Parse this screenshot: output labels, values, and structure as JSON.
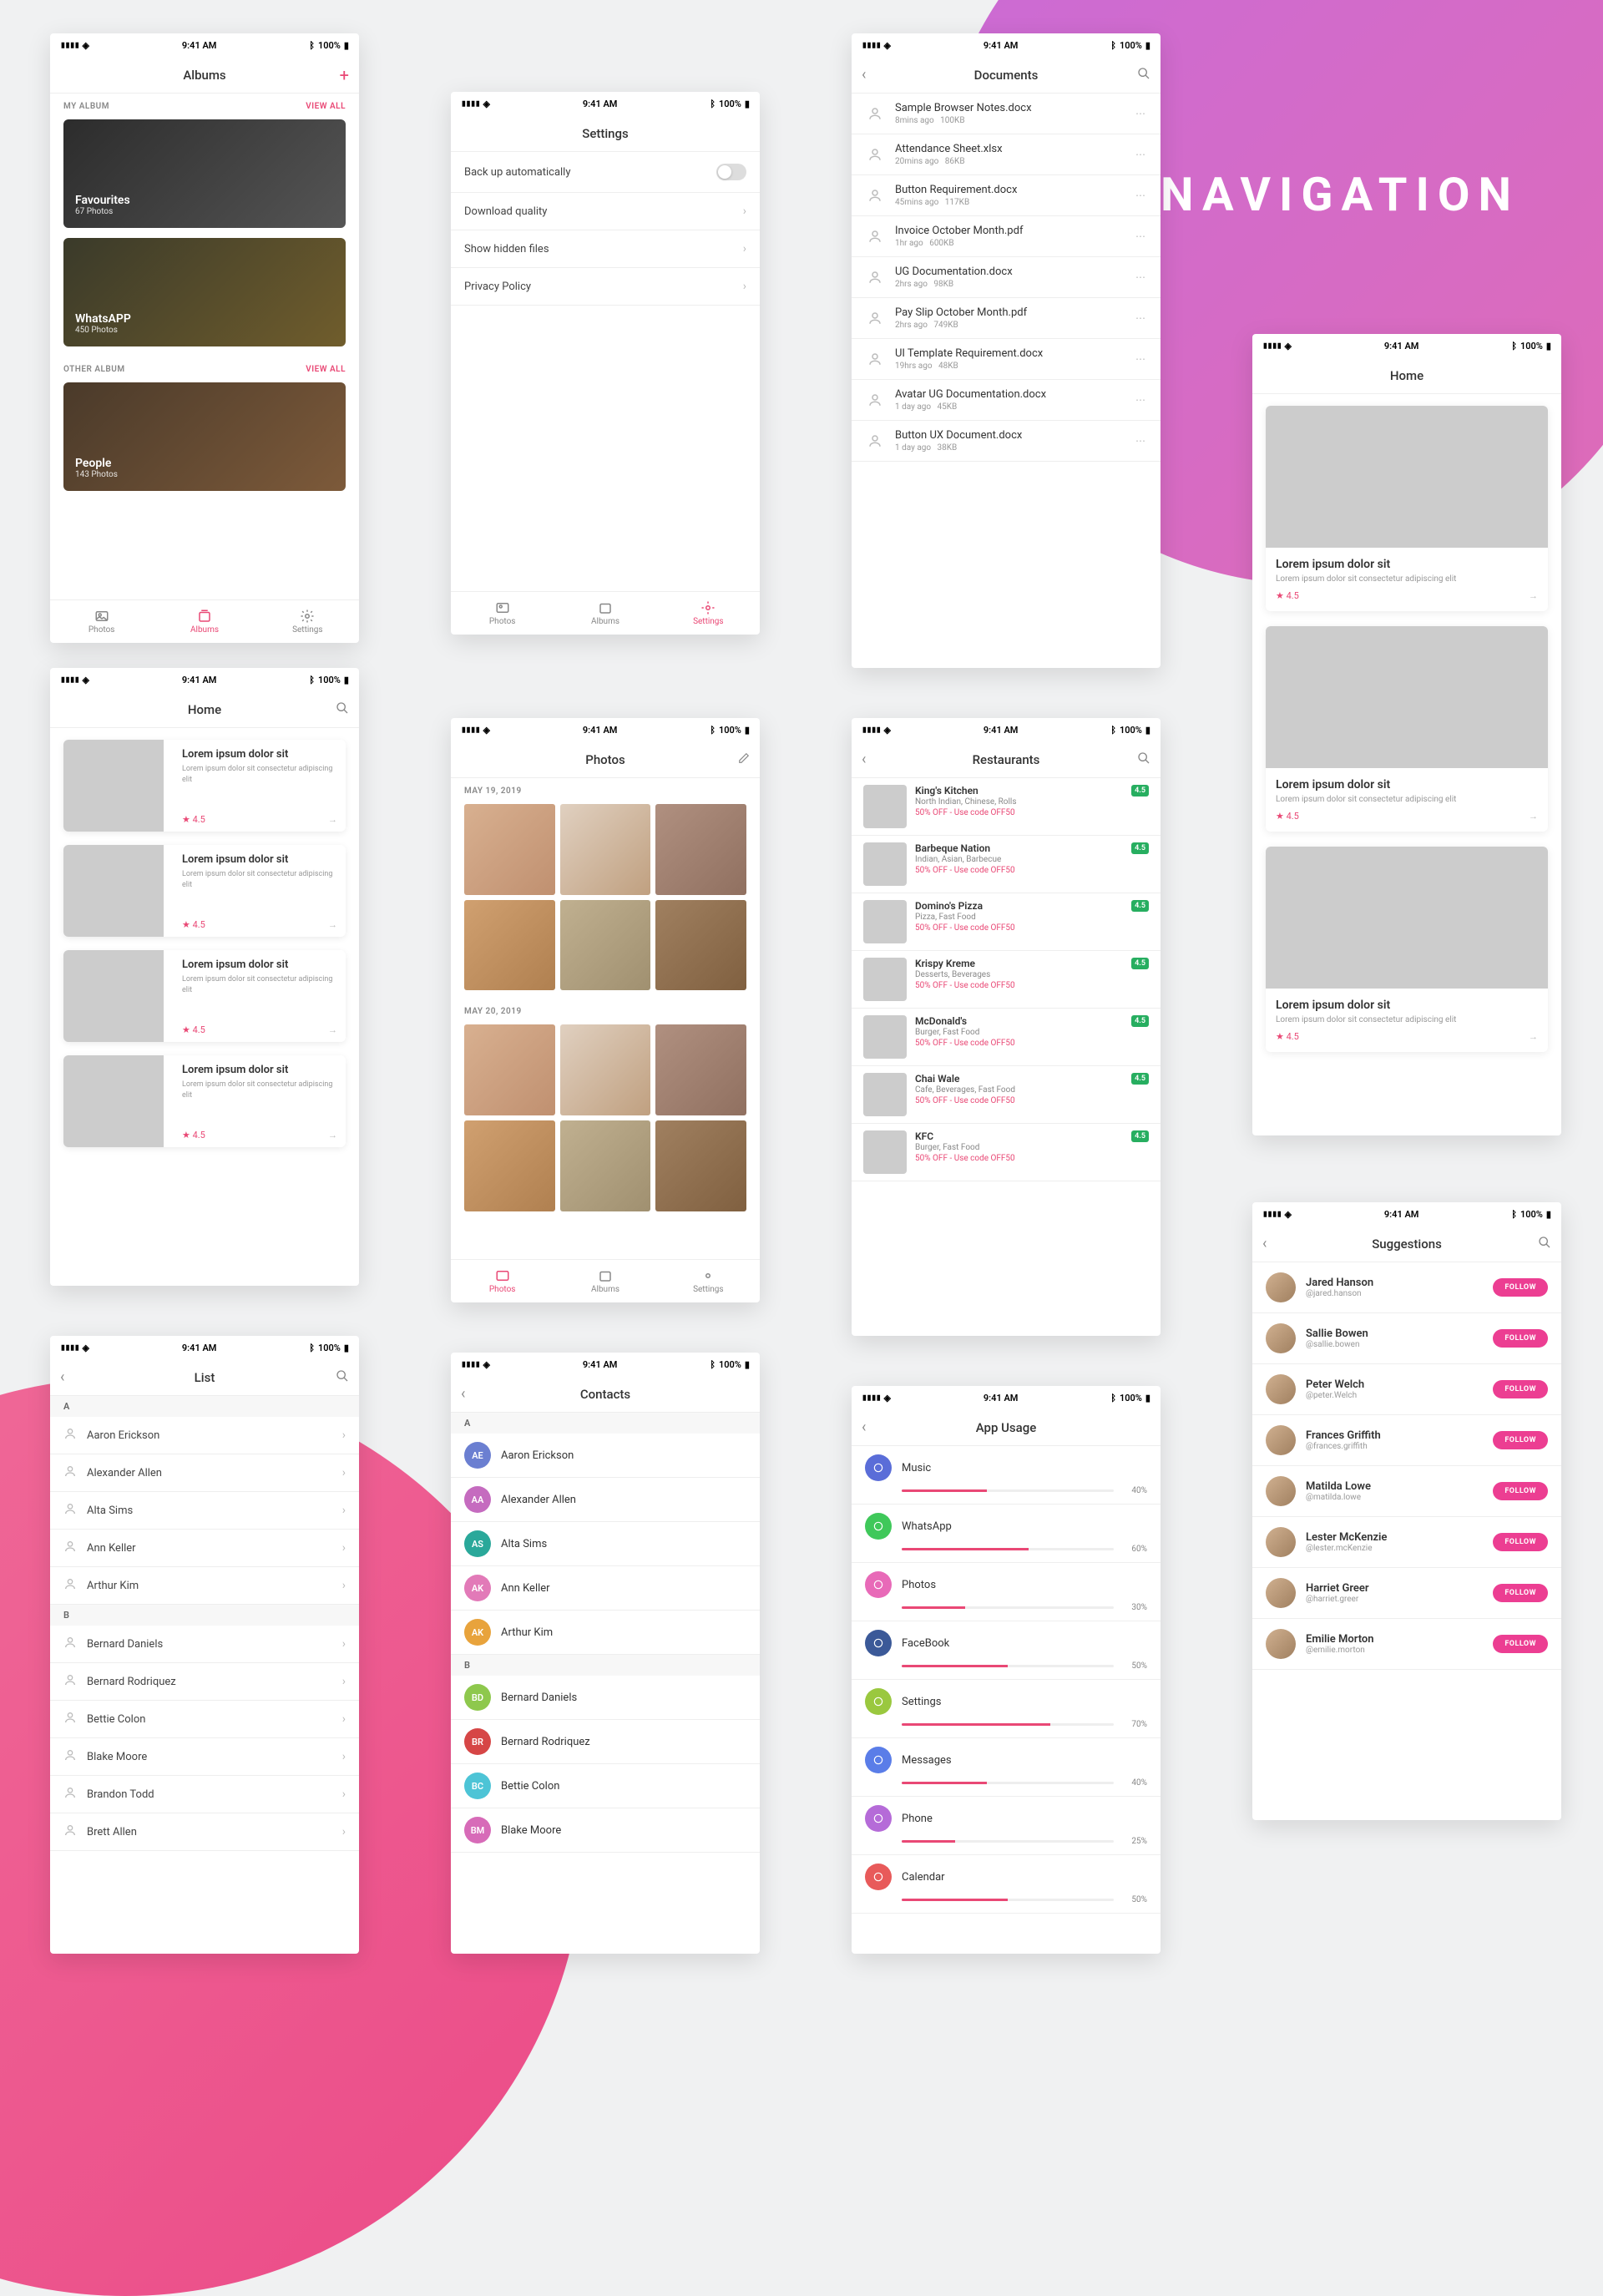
{
  "hero": "NAVIGATION",
  "statusbar": {
    "time": "9:41 AM",
    "battery": "100%"
  },
  "tabs": {
    "photos": "Photos",
    "albums": "Albums",
    "settings": "Settings"
  },
  "albums": {
    "title": "Albums",
    "sections": [
      {
        "header": "MY ALBUM",
        "viewall": "VIEW ALL",
        "cards": [
          {
            "title": "Favourites",
            "sub": "67 Photos"
          },
          {
            "title": "WhatsAPP",
            "sub": "450 Photos"
          }
        ]
      },
      {
        "header": "OTHER ALBUM",
        "viewall": "VIEW ALL",
        "cards": [
          {
            "title": "People",
            "sub": "143 Photos"
          }
        ]
      }
    ]
  },
  "settings": {
    "title": "Settings",
    "rows": [
      {
        "label": "Back up automatically",
        "type": "toggle"
      },
      {
        "label": "Download  quality",
        "type": "chev"
      },
      {
        "label": "Show hidden files",
        "type": "chev"
      },
      {
        "label": "Privacy Policy",
        "type": "chev"
      }
    ]
  },
  "documents": {
    "title": "Documents",
    "rows": [
      {
        "name": "Sample Browser Notes.docx",
        "time": "8mins ago",
        "size": "100KB"
      },
      {
        "name": "Attendance Sheet.xlsx",
        "time": "20mins ago",
        "size": "86KB"
      },
      {
        "name": "Button Requirement.docx",
        "time": "45mins ago",
        "size": "117KB"
      },
      {
        "name": "Invoice October Month.pdf",
        "time": "1hr ago",
        "size": "600KB"
      },
      {
        "name": "UG Documentation.docx",
        "time": "2hrs ago",
        "size": "98KB"
      },
      {
        "name": "Pay Slip October Month.pdf",
        "time": "2hrs ago",
        "size": "749KB"
      },
      {
        "name": "UI Template Requirement.docx",
        "time": "19hrs ago",
        "size": "48KB"
      },
      {
        "name": "Avatar UG Documentation.docx",
        "time": "1 day ago",
        "size": "45KB"
      },
      {
        "name": "Button UX Document.docx",
        "time": "1 day ago",
        "size": "38KB"
      }
    ]
  },
  "home": {
    "title": "Home",
    "items": [
      {
        "title": "Lorem ipsum dolor sit",
        "desc": "Lorem ipsum dolor sit consectetur adipiscing elit",
        "rating": "4.5"
      },
      {
        "title": "Lorem ipsum dolor sit",
        "desc": "Lorem ipsum dolor sit consectetur adipiscing elit",
        "rating": "4.5"
      },
      {
        "title": "Lorem ipsum dolor sit",
        "desc": "Lorem ipsum dolor sit consectetur adipiscing elit",
        "rating": "4.5"
      },
      {
        "title": "Lorem ipsum dolor sit",
        "desc": "Lorem ipsum dolor sit consectetur adipiscing elit",
        "rating": "4.5"
      }
    ]
  },
  "home2": {
    "title": "Home",
    "items": [
      {
        "title": "Lorem ipsum dolor sit",
        "desc": "Lorem ipsum dolor sit consectetur adipiscing elit",
        "rating": "4.5"
      },
      {
        "title": "Lorem ipsum dolor sit",
        "desc": "Lorem ipsum dolor sit consectetur adipiscing elit",
        "rating": "4.5"
      },
      {
        "title": "Lorem ipsum dolor sit",
        "desc": "Lorem ipsum dolor sit consectetur adipiscing elit",
        "rating": "4.5"
      }
    ]
  },
  "photos": {
    "title": "Photos",
    "groups": [
      {
        "date": "MAY 19, 2019",
        "count": 6
      },
      {
        "date": "MAY 20, 2019",
        "count": 6
      }
    ]
  },
  "restaurants": {
    "title": "Restaurants",
    "rows": [
      {
        "name": "King's Kitchen",
        "cat": "North Indian, Chinese, Rolls",
        "offer": "50% OFF - Use code OFF50",
        "rating": "4.5"
      },
      {
        "name": "Barbeque Nation",
        "cat": "Indian, Asian, Barbecue",
        "offer": "50% OFF - Use code OFF50",
        "rating": "4.5"
      },
      {
        "name": "Domino's Pizza",
        "cat": "Pizza, Fast Food",
        "offer": "50% OFF - Use code OFF50",
        "rating": "4.5"
      },
      {
        "name": "Krispy Kreme",
        "cat": "Desserts, Beverages",
        "offer": "50% OFF - Use code OFF50",
        "rating": "4.5"
      },
      {
        "name": "McDonald's",
        "cat": "Burger, Fast Food",
        "offer": "50% OFF - Use code OFF50",
        "rating": "4.5"
      },
      {
        "name": "Chai Wale",
        "cat": "Cafe, Beverages, Fast Food",
        "offer": "50% OFF - Use code OFF50",
        "rating": "4.5"
      },
      {
        "name": "KFC",
        "cat": "Burger, Fast Food",
        "offer": "50% OFF - Use code OFF50",
        "rating": "4.5"
      }
    ]
  },
  "list": {
    "title": "List",
    "sections": [
      {
        "letter": "A",
        "names": [
          "Aaron Erickson",
          "Alexander Allen",
          "Alta Sims",
          "Ann Keller",
          "Arthur Kim"
        ]
      },
      {
        "letter": "B",
        "names": [
          "Bernard Daniels",
          "Bernard Rodriquez",
          "Bettie Colon",
          "Blake Moore",
          "Brandon Todd",
          "Brett Allen"
        ]
      }
    ]
  },
  "contacts": {
    "title": "Contacts",
    "sections": [
      {
        "letter": "A",
        "people": [
          {
            "initials": "AE",
            "name": "Aaron Erickson",
            "color": "#6b7fd1"
          },
          {
            "initials": "AA",
            "name": "Alexander Allen",
            "color": "#c56bbf"
          },
          {
            "initials": "AS",
            "name": "Alta Sims",
            "color": "#2aa89a"
          },
          {
            "initials": "AK",
            "name": "Ann Keller",
            "color": "#e27ab8"
          },
          {
            "initials": "AK",
            "name": "Arthur Kim",
            "color": "#e8a33c"
          }
        ]
      },
      {
        "letter": "B",
        "people": [
          {
            "initials": "BD",
            "name": "Bernard Daniels",
            "color": "#8ec84d"
          },
          {
            "initials": "BR",
            "name": "Bernard Rodriquez",
            "color": "#d64646"
          },
          {
            "initials": "BC",
            "name": "Bettie Colon",
            "color": "#4dc4d6"
          },
          {
            "initials": "BM",
            "name": "Blake Moore",
            "color": "#d76bb8"
          }
        ]
      }
    ]
  },
  "usage": {
    "title": "App Usage",
    "rows": [
      {
        "name": "Music",
        "pct": 40,
        "color": "#5a6dd8"
      },
      {
        "name": "WhatsApp",
        "pct": 60,
        "color": "#3fc85a"
      },
      {
        "name": "Photos",
        "pct": 30,
        "color": "#e86ab8"
      },
      {
        "name": "FaceBook",
        "pct": 50,
        "color": "#3b5998"
      },
      {
        "name": "Settings",
        "pct": 70,
        "color": "#9ac83f"
      },
      {
        "name": "Messages",
        "pct": 40,
        "color": "#5a7de8"
      },
      {
        "name": "Phone",
        "pct": 25,
        "color": "#b56bd8"
      },
      {
        "name": "Calendar",
        "pct": 50,
        "color": "#e85a5a"
      }
    ]
  },
  "suggestions": {
    "title": "Suggestions",
    "button": "FOLLOW",
    "rows": [
      {
        "name": "Jared Hanson",
        "handle": "@jared.hanson"
      },
      {
        "name": "Sallie Bowen",
        "handle": "@sallie.bowen"
      },
      {
        "name": "Peter Welch",
        "handle": "@peter.Welch"
      },
      {
        "name": "Frances Griffith",
        "handle": "@frances.griffith"
      },
      {
        "name": "Matilda Lowe",
        "handle": "@matilda.lowe"
      },
      {
        "name": "Lester McKenzie",
        "handle": "@lester.mcKenzie"
      },
      {
        "name": "Harriet Greer",
        "handle": "@harriet.greer"
      },
      {
        "name": "Emilie Morton",
        "handle": "@emilie.morton"
      }
    ]
  }
}
